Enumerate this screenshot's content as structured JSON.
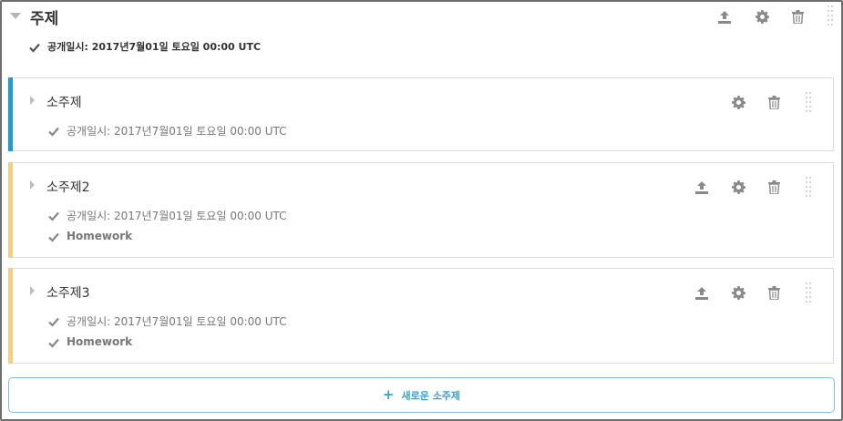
{
  "section": {
    "title": "주제",
    "release": "공개일시: 2017년7월01일 토요일 00:00 UTC"
  },
  "subsections": [
    {
      "title": "소주제",
      "release": "공개일시: 2017년7월01일 토요일 00:00 UTC",
      "extra": null,
      "accent": "#1a9ed9",
      "has_publish": false
    },
    {
      "title": "소주제2",
      "release": "공개일시: 2017년7월01일 토요일 00:00 UTC",
      "extra": "Homework",
      "accent": "#f2d07d",
      "has_publish": true
    },
    {
      "title": "소주제3",
      "release": "공개일시: 2017년7월01일 토요일 00:00 UTC",
      "extra": "Homework",
      "accent": "#f2d07d",
      "has_publish": true
    }
  ],
  "new_subsection_label": "새로운 소주제",
  "new_subsection_icon": "plus-icon",
  "icons": {
    "publish": "publish-icon",
    "settings": "gear-icon",
    "delete": "trash-icon",
    "drag": "drag-handle-icon",
    "check": "check-icon",
    "collapse": "caret-icon"
  },
  "colors": {
    "icon_gray": "#8a8a8a",
    "accent_blue": "#1a9ed9",
    "accent_yellow": "#f2d07d",
    "link_blue": "#3a9fd0"
  }
}
